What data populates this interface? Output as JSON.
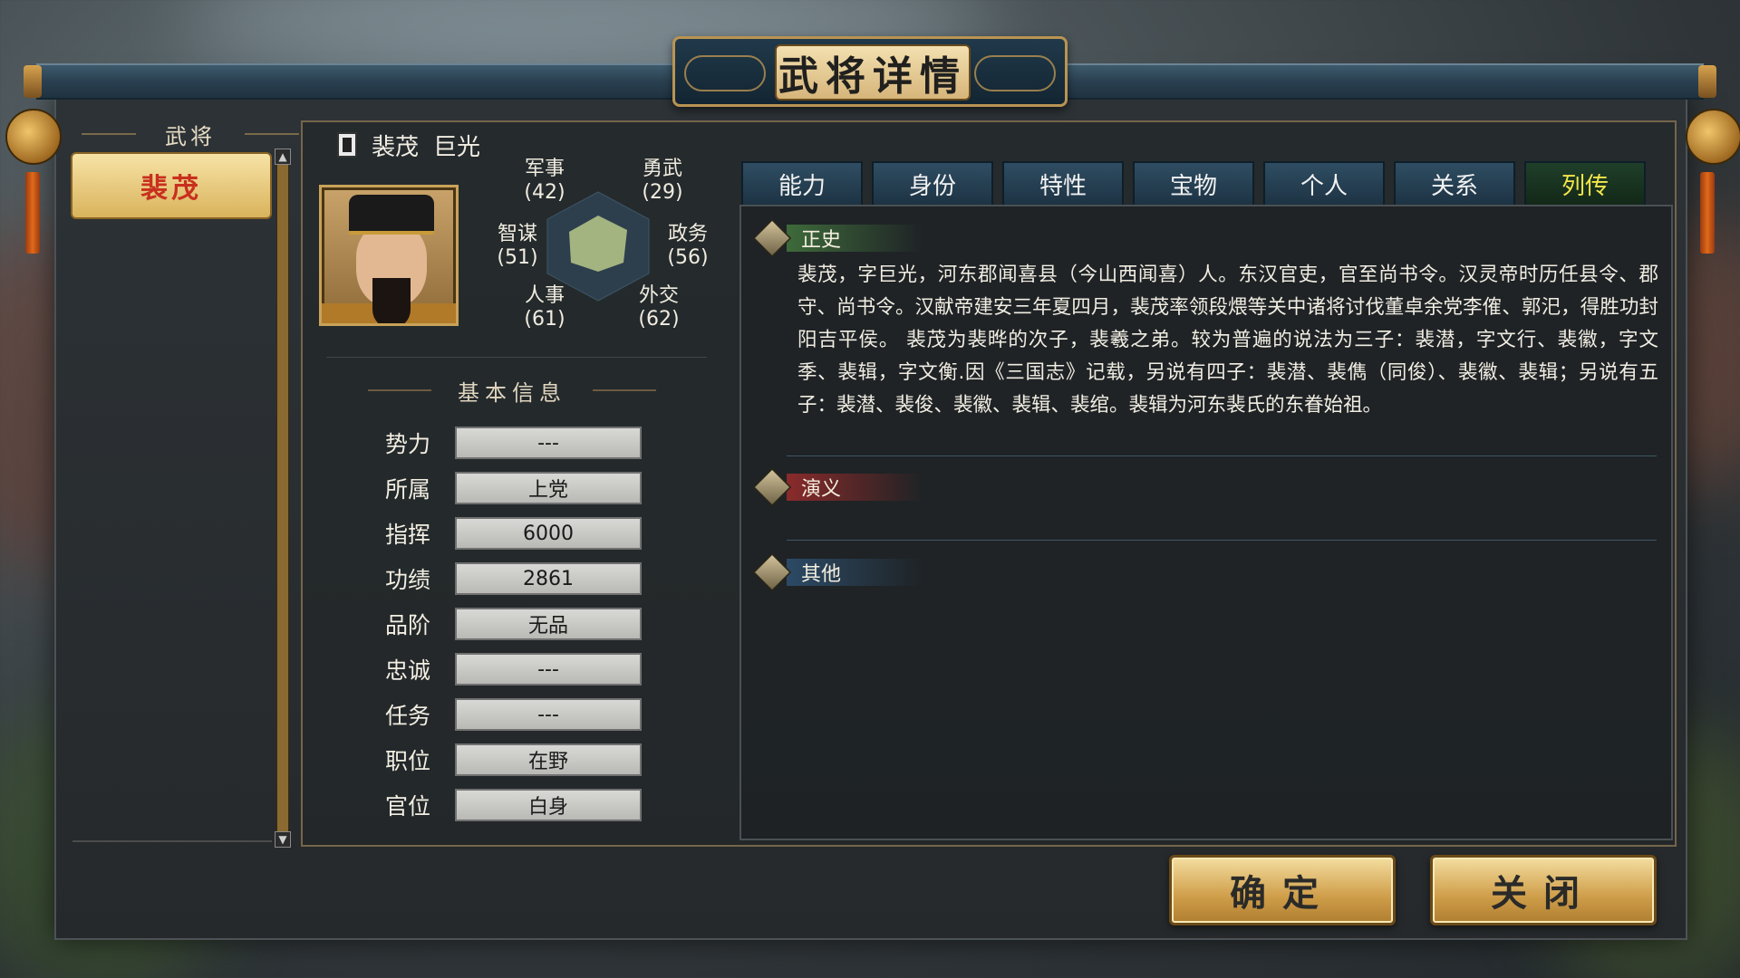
{
  "window": {
    "title": "武将详情"
  },
  "left_panel": {
    "header": "武将",
    "officers": [
      "裴茂"
    ]
  },
  "officer": {
    "name": "裴茂",
    "courtesy_name": "巨光",
    "portrait_icon": "general-portrait"
  },
  "stats": {
    "military": {
      "label": "军事",
      "value": "(42)"
    },
    "valor": {
      "label": "勇武",
      "value": "(29)"
    },
    "strategy": {
      "label": "智谋",
      "value": "(51)"
    },
    "politics": {
      "label": "政务",
      "value": "(56)"
    },
    "personnel": {
      "label": "人事",
      "value": "(61)"
    },
    "diplomacy": {
      "label": "外交",
      "value": "(62)"
    }
  },
  "basic_info": {
    "title": "基本信息",
    "rows": [
      {
        "label": "势力",
        "value": "---"
      },
      {
        "label": "所属",
        "value": "上党"
      },
      {
        "label": "指挥",
        "value": "6000"
      },
      {
        "label": "功绩",
        "value": "2861"
      },
      {
        "label": "品阶",
        "value": "无品"
      },
      {
        "label": "忠诚",
        "value": "---"
      },
      {
        "label": "任务",
        "value": "---"
      },
      {
        "label": "职位",
        "value": "在野"
      },
      {
        "label": "官位",
        "value": "白身"
      }
    ]
  },
  "tabs": [
    {
      "label": "能力",
      "active": false
    },
    {
      "label": "身份",
      "active": false
    },
    {
      "label": "特性",
      "active": false
    },
    {
      "label": "宝物",
      "active": false
    },
    {
      "label": "个人",
      "active": false
    },
    {
      "label": "关系",
      "active": false
    },
    {
      "label": "列传",
      "active": true
    }
  ],
  "biography": {
    "sections": [
      {
        "title": "正史",
        "text": "裴茂，字巨光，河东郡闻喜县（今山西闻喜）人。东汉官吏，官至尚书令。汉灵帝时历任县令、郡守、尚书令。汉献帝建安三年夏四月，裴茂率领段煨等关中诸将讨伐董卓余党李傕、郭汜，得胜功封阳吉平侯。 裴茂为裴晔的次子，裴羲之弟。较为普遍的说法为三子：裴潜，字文行、裴徽，字文季、裴辑，字文衡.因《三国志》记载，另说有四子：裴潜、裴儁（同俊）、裴徽、裴辑；另说有五子：裴潜、裴俊、裴徽、裴辑、裴绾。裴辑为河东裴氏的东眷始祖。"
      },
      {
        "title": "演义",
        "text": ""
      },
      {
        "title": "其他",
        "text": ""
      }
    ]
  },
  "buttons": {
    "ok": "确定",
    "close": "关闭"
  },
  "colors": {
    "accent_gold": "#d9b35c",
    "active_tab_text": "#f4e64a",
    "officer_name_red": "#c8301e"
  }
}
